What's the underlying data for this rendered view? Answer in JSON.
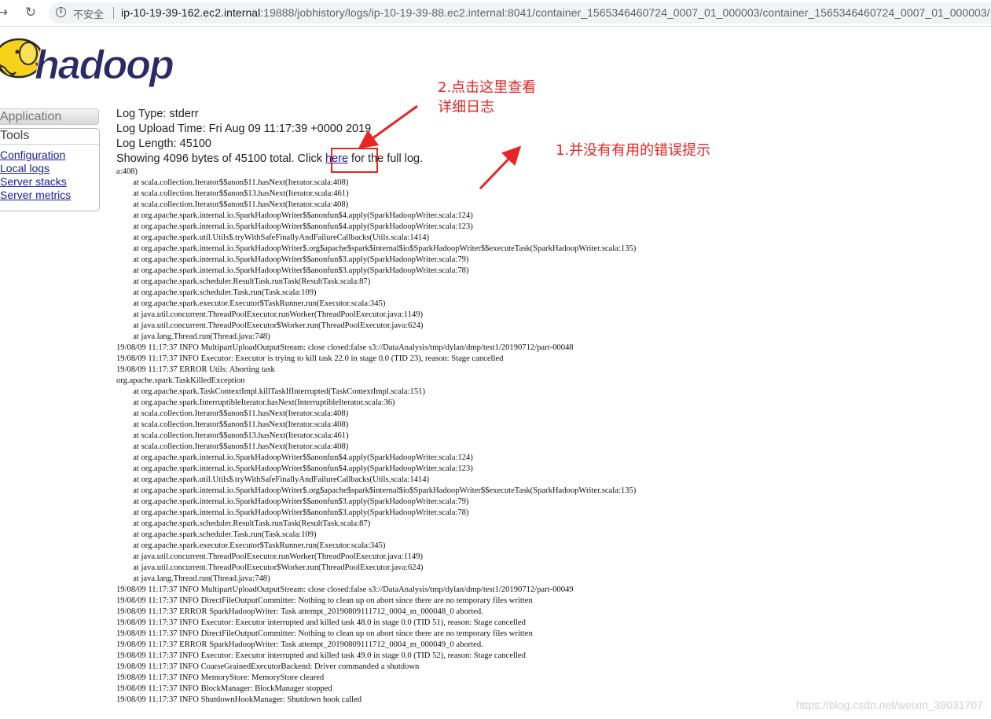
{
  "browser": {
    "security_label": "不安全",
    "url_host": "ip-10-19-39-162.ec2.internal",
    "url_rest": ":19888/jobhistory/logs/ip-10-19-39-88.ec2.internal:8041/container_1565346460724_0007_01_000003/container_1565346460724_0007_01_000003/"
  },
  "logo": {
    "text": "hadoop"
  },
  "nav": {
    "application_label": "Application",
    "tools_label": "Tools",
    "tool_links": [
      "Configuration",
      "Local logs",
      "Server stacks",
      "Server metrics"
    ]
  },
  "log": {
    "type_line": "Log Type: stderr",
    "upload_line": "Log Upload Time: Fri Aug 09 11:17:39 +0000 2019",
    "length_line": "Log Length: 45100",
    "showing_prefix": "Showing 4096 bytes of 45100 total. Click ",
    "here_link": "here",
    "showing_suffix": " for the full log.",
    "lines": [
      "a:408)",
      "        at scala.collection.Iterator$$anon$11.hasNext(Iterator.scala:408)",
      "        at scala.collection.Iterator$$anon$13.hasNext(Iterator.scala:461)",
      "        at scala.collection.Iterator$$anon$11.hasNext(Iterator.scala:408)",
      "        at org.apache.spark.internal.io.SparkHadoopWriter$$anonfun$4.apply(SparkHadoopWriter.scala:124)",
      "        at org.apache.spark.internal.io.SparkHadoopWriter$$anonfun$4.apply(SparkHadoopWriter.scala:123)",
      "        at org.apache.spark.util.Utils$.tryWithSafeFinallyAndFailureCallbacks(Utils.scala:1414)",
      "        at org.apache.spark.internal.io.SparkHadoopWriter$.org$apache$spark$internal$io$SparkHadoopWriter$$executeTask(SparkHadoopWriter.scala:135)",
      "        at org.apache.spark.internal.io.SparkHadoopWriter$$anonfun$3.apply(SparkHadoopWriter.scala:79)",
      "        at org.apache.spark.internal.io.SparkHadoopWriter$$anonfun$3.apply(SparkHadoopWriter.scala:78)",
      "        at org.apache.spark.scheduler.ResultTask.runTask(ResultTask.scala:87)",
      "        at org.apache.spark.scheduler.Task.run(Task.scala:109)",
      "        at org.apache.spark.executor.Executor$TaskRunner.run(Executor.scala:345)",
      "        at java.util.concurrent.ThreadPoolExecutor.runWorker(ThreadPoolExecutor.java:1149)",
      "        at java.util.concurrent.ThreadPoolExecutor$Worker.run(ThreadPoolExecutor.java:624)",
      "        at java.lang.Thread.run(Thread.java:748)",
      "19/08/09 11:17:37 INFO MultipartUploadOutputStream: close closed:false s3://DataAnalysis/tmp/dylan/dmp/test1/20190712/part-00048",
      "19/08/09 11:17:37 INFO Executor: Executor is trying to kill task 22.0 in stage 0.0 (TID 23), reason: Stage cancelled",
      "19/08/09 11:17:37 ERROR Utils: Aborting task",
      "org.apache.spark.TaskKilledException",
      "        at org.apache.spark.TaskContextImpl.killTaskIfInterrupted(TaskContextImpl.scala:151)",
      "        at org.apache.spark.InterruptibleIterator.hasNext(InterruptibleIterator.scala:36)",
      "        at scala.collection.Iterator$$anon$11.hasNext(Iterator.scala:408)",
      "        at scala.collection.Iterator$$anon$11.hasNext(Iterator.scala:408)",
      "        at scala.collection.Iterator$$anon$13.hasNext(Iterator.scala:461)",
      "        at scala.collection.Iterator$$anon$11.hasNext(Iterator.scala:408)",
      "        at org.apache.spark.internal.io.SparkHadoopWriter$$anonfun$4.apply(SparkHadoopWriter.scala:124)",
      "        at org.apache.spark.internal.io.SparkHadoopWriter$$anonfun$4.apply(SparkHadoopWriter.scala:123)",
      "        at org.apache.spark.util.Utils$.tryWithSafeFinallyAndFailureCallbacks(Utils.scala:1414)",
      "        at org.apache.spark.internal.io.SparkHadoopWriter$.org$apache$spark$internal$io$SparkHadoopWriter$$executeTask(SparkHadoopWriter.scala:135)",
      "        at org.apache.spark.internal.io.SparkHadoopWriter$$anonfun$3.apply(SparkHadoopWriter.scala:79)",
      "        at org.apache.spark.internal.io.SparkHadoopWriter$$anonfun$3.apply(SparkHadoopWriter.scala:78)",
      "        at org.apache.spark.scheduler.ResultTask.runTask(ResultTask.scala:87)",
      "        at org.apache.spark.scheduler.Task.run(Task.scala:109)",
      "        at org.apache.spark.executor.Executor$TaskRunner.run(Executor.scala:345)",
      "        at java.util.concurrent.ThreadPoolExecutor.runWorker(ThreadPoolExecutor.java:1149)",
      "        at java.util.concurrent.ThreadPoolExecutor$Worker.run(ThreadPoolExecutor.java:624)",
      "        at java.lang.Thread.run(Thread.java:748)",
      "19/08/09 11:17:37 INFO MultipartUploadOutputStream: close closed:false s3://DataAnalysis/tmp/dylan/dmp/test1/20190712/part-00049",
      "19/08/09 11:17:37 INFO DirectFileOutputCommitter: Nothing to clean up on abort since there are no temporary files written",
      "19/08/09 11:17:37 ERROR SparkHadoopWriter: Task attempt_20190809111712_0004_m_000048_0 aborted.",
      "19/08/09 11:17:37 INFO Executor: Executor interrupted and killed task 48.0 in stage 0.0 (TID 51), reason: Stage cancelled",
      "19/08/09 11:17:37 INFO DirectFileOutputCommitter: Nothing to clean up on abort since there are no temporary files written",
      "19/08/09 11:17:37 ERROR SparkHadoopWriter: Task attempt_20190809111712_0004_m_000049_0 aborted.",
      "19/08/09 11:17:37 INFO Executor: Executor interrupted and killed task 49.0 in stage 0.0 (TID 52), reason: Stage cancelled",
      "19/08/09 11:17:37 INFO CoarseGrainedExecutorBackend: Driver commanded a shutdown",
      "19/08/09 11:17:37 INFO MemoryStore: MemoryStore cleared",
      "19/08/09 11:17:37 INFO BlockManager: BlockManager stopped",
      "19/08/09 11:17:37 INFO ShutdownHookManager: Shutdown hook called"
    ]
  },
  "annotations": {
    "note2_line1": "2.点击这里查看",
    "note2_line2": "详细日志",
    "note1": "1.并没有有用的错误提示",
    "color": "#e82424"
  },
  "watermark": "https://blog.csdn.net/weixin_39031707"
}
